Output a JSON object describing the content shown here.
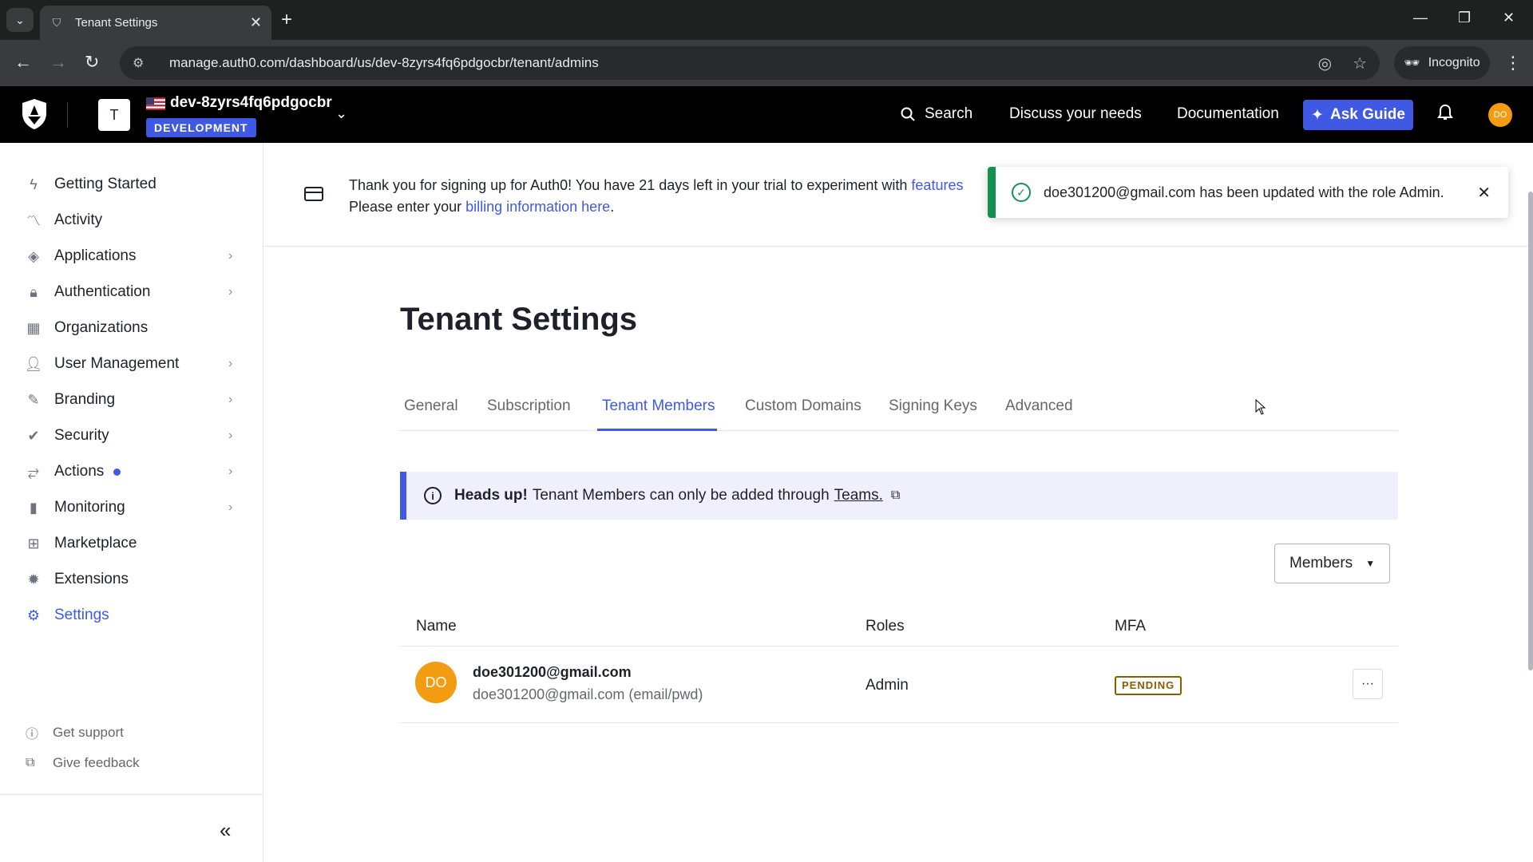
{
  "browser": {
    "tab_title": "Tenant Settings",
    "url": "manage.auth0.com/dashboard/us/dev-8zyrs4fq6pdgocbr/tenant/admins",
    "incognito_label": "Incognito"
  },
  "header": {
    "tenant_initial": "T",
    "tenant_name": "dev-8zyrs4fq6pdgocbr",
    "environment_badge": "DEVELOPMENT",
    "search_label": "Search",
    "discuss_label": "Discuss your needs",
    "docs_label": "Documentation",
    "ask_guide_label": "Ask Guide",
    "user_initials": "DO"
  },
  "sidebar": {
    "items": [
      {
        "label": "Getting Started",
        "icon": "bolt-icon"
      },
      {
        "label": "Activity",
        "icon": "activity-icon"
      },
      {
        "label": "Applications",
        "icon": "layers-icon"
      },
      {
        "label": "Authentication",
        "icon": "lock-icon"
      },
      {
        "label": "Organizations",
        "icon": "building-icon"
      },
      {
        "label": "User Management",
        "icon": "users-icon"
      },
      {
        "label": "Branding",
        "icon": "brush-icon"
      },
      {
        "label": "Security",
        "icon": "shield-icon"
      },
      {
        "label": "Actions",
        "icon": "flow-icon"
      },
      {
        "label": "Monitoring",
        "icon": "bar-chart-icon"
      },
      {
        "label": "Marketplace",
        "icon": "grid-plus-icon"
      },
      {
        "label": "Extensions",
        "icon": "puzzle-icon"
      },
      {
        "label": "Settings",
        "icon": "gear-icon"
      }
    ],
    "footer": {
      "support_label": "Get support",
      "feedback_label": "Give feedback"
    },
    "collapse_glyph": "«"
  },
  "banner": {
    "line1_prefix": "Thank you for signing up for Auth0! You have 21 days left in your trial to experiment with ",
    "line1_link": "features",
    "line2_prefix": "Please enter your ",
    "line2_link": "billing information here",
    "line2_suffix": "."
  },
  "toast": {
    "message": "doe301200@gmail.com has been updated with the role Admin."
  },
  "page": {
    "title": "Tenant Settings",
    "tabs": [
      "General",
      "Subscription",
      "Tenant Members",
      "Custom Domains",
      "Signing Keys",
      "Advanced"
    ],
    "active_tab": "Tenant Members"
  },
  "info": {
    "heading": "Heads up!",
    "text": "Tenant Members can only be added through",
    "link": "Teams."
  },
  "filter": {
    "selected": "Members"
  },
  "table": {
    "columns": [
      "Name",
      "Roles",
      "MFA"
    ],
    "rows": [
      {
        "initials": "DO",
        "email": "doe301200@gmail.com",
        "subtitle": "doe301200@gmail.com (email/pwd)",
        "role": "Admin",
        "mfa": "PENDING"
      }
    ]
  },
  "colors": {
    "accent": "#3f59e4",
    "success": "#16904f",
    "avatar": "#f39c12",
    "pending": "#8a5d00"
  }
}
